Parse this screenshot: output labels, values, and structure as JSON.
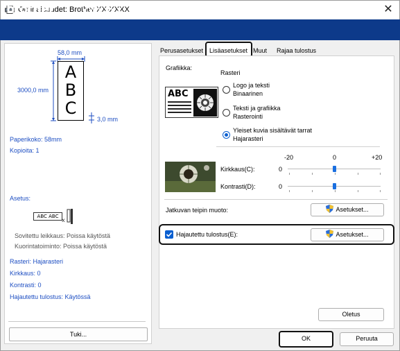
{
  "window": {
    "title": "Ominaisuudet: Brother XX-XXXX",
    "close_glyph": "✕",
    "icon": "printer-icon"
  },
  "brand": {
    "logo": "brother",
    "model": "XX-XXXX"
  },
  "preview": {
    "width_label": "58,0 mm",
    "length_label": "3000,0 mm",
    "margin_label": "3,0 mm",
    "letters": [
      "A",
      "B",
      "C"
    ]
  },
  "summary": {
    "paper_size": "Paperikoko: 58mm",
    "copies": "Kopioita: 1",
    "setting_title": "Asetus:",
    "auto_cut": "Sovitettu leikkaus: Poissa käytöstä",
    "overwrite": "Kuorintatoiminto: Poissa käytöstä",
    "raster": "Rasteri: Hajarasteri",
    "brightness": "Kirkkaus:   0",
    "contrast": "Kontrasti:   0",
    "distributed": "Hajautettu tulostus: Käytössä",
    "setting_image_text": "ABC ABC"
  },
  "support_button": "Tuki...",
  "tabs": [
    {
      "label": "Perusasetukset",
      "active": false
    },
    {
      "label": "Lisäasetukset",
      "active": true
    },
    {
      "label": "Muut",
      "active": false
    },
    {
      "label": "Rajaa tulostus",
      "active": false
    }
  ],
  "graphics": {
    "label": "Grafiikka:",
    "mode": "Rasteri",
    "sample_text": "ABC",
    "options": [
      {
        "line1": "Logo ja teksti",
        "line2": "Binaarinen",
        "selected": false
      },
      {
        "line1": "Teksti ja grafiikka",
        "line2": "Rasterointi",
        "selected": false
      },
      {
        "line1": "Yleiset kuvia sisältävät tarrat",
        "line2": "Hajarasteri",
        "selected": true
      }
    ]
  },
  "adjust": {
    "scale_min": "-20",
    "scale_mid": "0",
    "scale_max": "+20",
    "brightness_label": "Kirkkaus(C):",
    "brightness_value": "0",
    "contrast_label": "Kontrasti(D):",
    "contrast_value": "0"
  },
  "tape_format": {
    "label": "Jatkuvan teipin muoto:",
    "button": "Asetukset..."
  },
  "distributed": {
    "label": "Hajautettu tulostus(E):",
    "checked": true,
    "button": "Asetukset..."
  },
  "defaults_button": "Oletus",
  "ok_button": "OK",
  "cancel_button": "Peruuta",
  "colors": {
    "brand_bar": "#0d3a8a",
    "accent_blue": "#1d4ec2",
    "checkbox": "#0a5fd0"
  }
}
